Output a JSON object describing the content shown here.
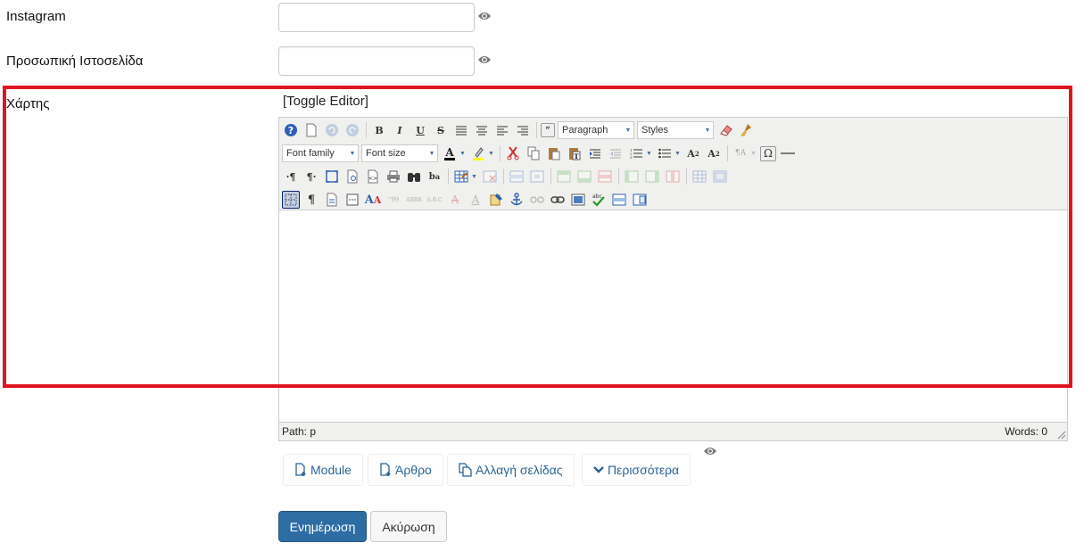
{
  "fields": [
    {
      "label": "Instagram",
      "value": ""
    },
    {
      "label": "Προσωπική Ιστοσελίδα",
      "value": ""
    }
  ],
  "map_field": {
    "label": "Χάρτης",
    "toggle_editor": "[Toggle Editor]"
  },
  "editor": {
    "format_select": "Paragraph",
    "styles_select": "Styles",
    "font_family_select": "Font family",
    "font_size_select": "Font size",
    "status_path": "Path:  p",
    "word_count": "Words: 0",
    "content": ""
  },
  "extra_buttons": {
    "module": "Module",
    "article": "Άρθρο",
    "pagebreak": "Αλλαγή σελίδας",
    "more": "Περισσότερα"
  },
  "actions": {
    "update": "Ενημέρωση",
    "cancel": "Ακύρωση"
  },
  "colors": {
    "highlight": "#e0141f",
    "primary": "#2e6da4",
    "link": "#2a6496"
  }
}
